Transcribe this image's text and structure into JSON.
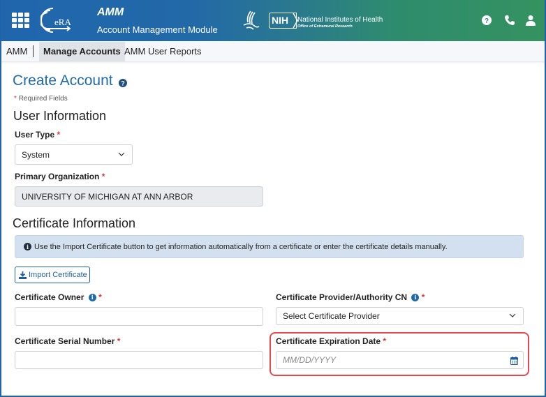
{
  "header": {
    "app_title": "AMM",
    "app_subtitle": "Account Management Module",
    "logo_text": "eRA",
    "nih_badge": "NIH",
    "nih_title": "National Institutes of Health",
    "nih_subtitle": "Office of Extramural Research",
    "icons": [
      "apps-grid-icon",
      "help-icon",
      "phone-icon",
      "user-icon"
    ]
  },
  "nav": {
    "root": "AMM",
    "items": [
      {
        "label": "Manage Accounts",
        "active": true
      },
      {
        "label": "AMM User Reports",
        "active": false
      }
    ]
  },
  "page": {
    "title": "Create Account",
    "required_note": "Required Fields",
    "required_mark": "*"
  },
  "user_info": {
    "heading": "User Information",
    "user_type_label": "User Type",
    "user_type_value": "System",
    "org_label": "Primary Organization",
    "org_value": "UNIVERSITY OF MICHIGAN AT ANN ARBOR"
  },
  "cert_info": {
    "heading": "Certificate Information",
    "info_message": "Use the Import Certificate button to get information automatically from a certificate or enter the certificate details manually.",
    "import_button": "Import Certificate",
    "owner_label": "Certificate Owner",
    "owner_value": "",
    "provider_label": "Certificate Provider/Authority CN",
    "provider_value": "Select Certificate Provider",
    "serial_label": "Certificate Serial Number",
    "serial_value": "",
    "expiration_label": "Certificate Expiration Date",
    "expiration_placeholder": "MM/DD/YYYY"
  },
  "colors": {
    "accent": "#1f6aab",
    "required": "#d9363e",
    "highlight": "#e8474c",
    "header_start": "#1f66ad",
    "header_end": "#359260"
  }
}
